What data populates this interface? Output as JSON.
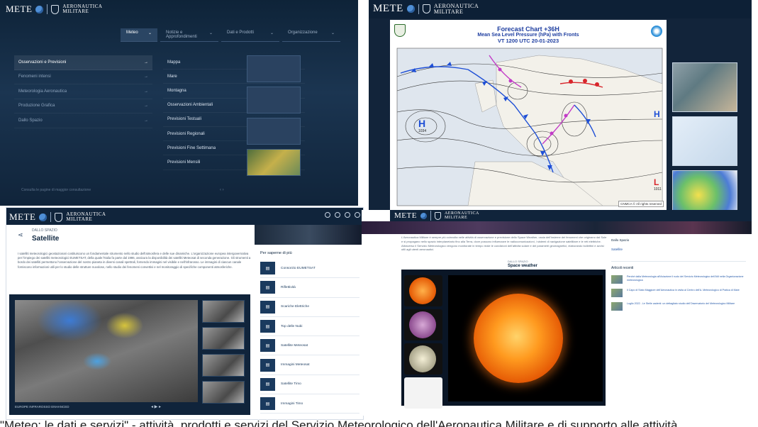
{
  "panel_menu": {
    "brand": {
      "meteo": "METE",
      "org_line1": "AERONAUTICA",
      "org_line2": "MILITARE"
    },
    "nav": [
      {
        "label": "Meteo",
        "icon": "chevron-down-icon"
      },
      {
        "label": "Notizie e Approfondimenti",
        "icon": "chevron-down-icon"
      },
      {
        "label": "Dati e Prodotti",
        "icon": "chevron-down-icon"
      },
      {
        "label": "Organizzazione",
        "icon": "chevron-down-icon"
      }
    ],
    "left_items": [
      {
        "label": "Osservazioni e Previsioni",
        "arrow": "→"
      },
      {
        "label": "Fenomeni intensi",
        "arrow": "→"
      },
      {
        "label": "Meteorologia Aeronautica",
        "arrow": "→"
      },
      {
        "label": "Produzione Grafica",
        "arrow": "→"
      },
      {
        "label": "Dallo Spazio",
        "arrow": "→"
      }
    ],
    "mid_items": [
      {
        "label": "Mappa",
        "arrow": ""
      },
      {
        "label": "Mare",
        "arrow": "→"
      },
      {
        "label": "Montagna",
        "arrow": "→"
      },
      {
        "label": "Osservazioni Ambientali",
        "arrow": "→"
      },
      {
        "label": "Previsioni Testuali",
        "arrow": ""
      },
      {
        "label": "Previsioni Regionali",
        "arrow": "→"
      },
      {
        "label": "Previsioni Fine Settimana",
        "arrow": ""
      },
      {
        "label": "Previsioni Mensili",
        "arrow": ""
      }
    ],
    "footer": "Consulta le pagine di maggior consultazione",
    "pager": "‹  ›"
  },
  "panel_chart": {
    "brand": {
      "meteo": "METE",
      "org_line1": "AERONAUTICA",
      "org_line2": "MILITARE"
    },
    "title_line1": "Forecast Chart +36H",
    "title_line2": "Mean Sea Level Pressure (hPa) with Fronts",
    "title_line3": "VT 1200 UTC 20-01-2023",
    "high_label": "H",
    "high_value": "1034",
    "high_right_label": "H",
    "low_label": "L",
    "low_value": "1011",
    "copyright": "CNMCA © All rights reserved",
    "colors": {
      "warm_front": "#d8262c",
      "cold_front": "#1e4fd6",
      "occluded_front": "#c23bc7",
      "isobar": "#3a3a3a"
    }
  },
  "panel_satellite": {
    "brand": {
      "meteo": "METE",
      "org_line1": "AERONAUTICA",
      "org_line2": "MILITARE"
    },
    "breadcrumb": "DALLO SPAZIO",
    "title": "Satellite",
    "paragraph": "I satelliti meteorologici geostazionari costituiscono un fondamentale strumento nello studio dell'atmosfera e delle sue dinamiche. L'organizzazione europea intergovernativa per l'impiego dei satelliti meteorologici EUMETSAT, della quale l'Italia fa parte dal 1986, assicura la disponibilità dei satelliti Meteosat di seconda generazione. Gli strumenti a bordo dei satelliti permettono l'osservazione del nostro pianeta in diversi canali spettrali, fornendo immagini nel visibile e nell'infrarosso. Le immagini di ciascun canale forniscono informazioni utili per lo studio delle strutture nuvolose, nello studio dei fenomeni convettivi e nel monitoraggio di specifiche componenti atmosferiche.",
    "image_caption": "EUROPE INFRAROSSO ENHANCED",
    "player_controls": "◂  ▶  ▸",
    "more_heading": "Per saperne di più",
    "more_items": [
      "Consorzio EUMETSAT",
      "Riflettività",
      "Scariche Elettriche",
      "Top delle Nubi",
      "Satellite Meteosat",
      "Immagini Meteosat",
      "Satellite Timo",
      "Immagini Timo"
    ]
  },
  "panel_space": {
    "brand": {
      "meteo": "METE",
      "org_line1": "AERONAUTICA",
      "org_line2": "MILITARE"
    },
    "breadcrumb": "DALLO SPAZIO",
    "title": "Space weather",
    "paragraph": "L'Aeronautica Militare è sempre più coinvolta nelle attività di osservazione e previsione dello Space Weather, ossia dell'insieme dei fenomeni che originano dal Sole e si propagano nello spazio interplanetario fino alla Terra, dove possono influenzare le radiocomunicazioni, i sistemi di navigazione satellitare e le reti elettriche. Attraverso il Servizio Meteorologico vengono monitorate in tempo reale le condizioni dell'attività solare e dei parametri geomagnetici, elaborando bollettini e avvisi utili agli utenti aeronautici.",
    "sidebar_heading": "Dallo Spazio",
    "sidebar_link": "Satellite",
    "news_heading": "Articoli recenti",
    "news": [
      "Perché dalla Meteorologia all'Aviazione il ruolo del Servizio Meteorologico dell'AM nella Organizzazione meteorologica",
      "Il Capo di Stato Maggiore dell'Aeronautica in visita al Centro dell'A. Meteorologico di Pratica di Mare",
      "Luglio 2022 - Le Stelle cadenti: un dettagliato studio dell'Osservatorio del Meteorologico Militare"
    ]
  },
  "caption": "\"Meteo: le dati e servizi\" - attività, prodotti e servizi del Servizio Meteorologico dell'Aeronautica Militare e di supporto alle attività"
}
